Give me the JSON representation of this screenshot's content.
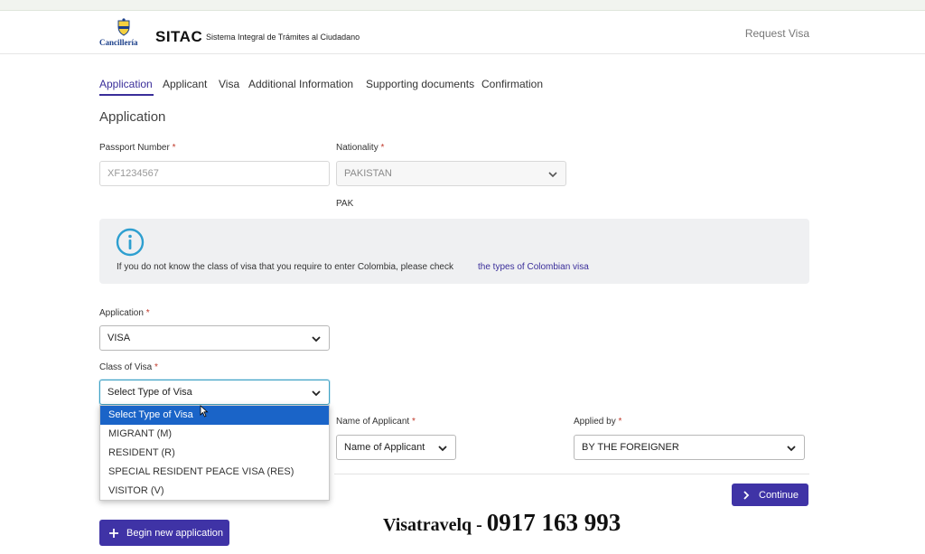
{
  "header": {
    "logo_name": "Cancillería",
    "brand": "SITAC",
    "brand_subtitle": "Sistema Integral de Trámites al Ciudadano",
    "request_visa": "Request Visa"
  },
  "tabs": [
    {
      "label": "Application",
      "active": true
    },
    {
      "label": "Applicant",
      "active": false
    },
    {
      "label": "Visa",
      "active": false
    },
    {
      "label": "Additional Information",
      "active": false
    },
    {
      "label": "Supporting documents",
      "active": false
    },
    {
      "label": "Confirmation",
      "active": false
    }
  ],
  "section_title": "Application",
  "required_mark": "*",
  "passport": {
    "label": "Passport Number",
    "placeholder": "XF1234567"
  },
  "nationality": {
    "label": "Nationality",
    "value": "PAKISTAN",
    "code": "PAK"
  },
  "info": {
    "text": "If you do not know the class of visa that you require to enter Colombia, please check",
    "link": "the types of Colombian visa"
  },
  "application": {
    "label": "Application",
    "value": "VISA"
  },
  "class_of_visa": {
    "label": "Class of Visa",
    "value": "Select Type of Visa",
    "options": [
      "Select Type of Visa",
      "MIGRANT (M)",
      "RESIDENT (R)",
      "SPECIAL RESIDENT PEACE VISA (RES)",
      "VISITOR (V)"
    ]
  },
  "name_of_applicant": {
    "label": "Name of Applicant",
    "value": "Name of Applicant"
  },
  "applied_by": {
    "label": "Applied by",
    "value": "BY THE FOREIGNER"
  },
  "buttons": {
    "continue": "Continue",
    "begin_new": "Begin new application"
  },
  "watermark": {
    "name": "Visatravelq - ",
    "phone": "0917 163 993"
  },
  "colors": {
    "accent": "#3f33a6",
    "selected": "#1a64c8",
    "info_icon": "#2e9fd0"
  }
}
